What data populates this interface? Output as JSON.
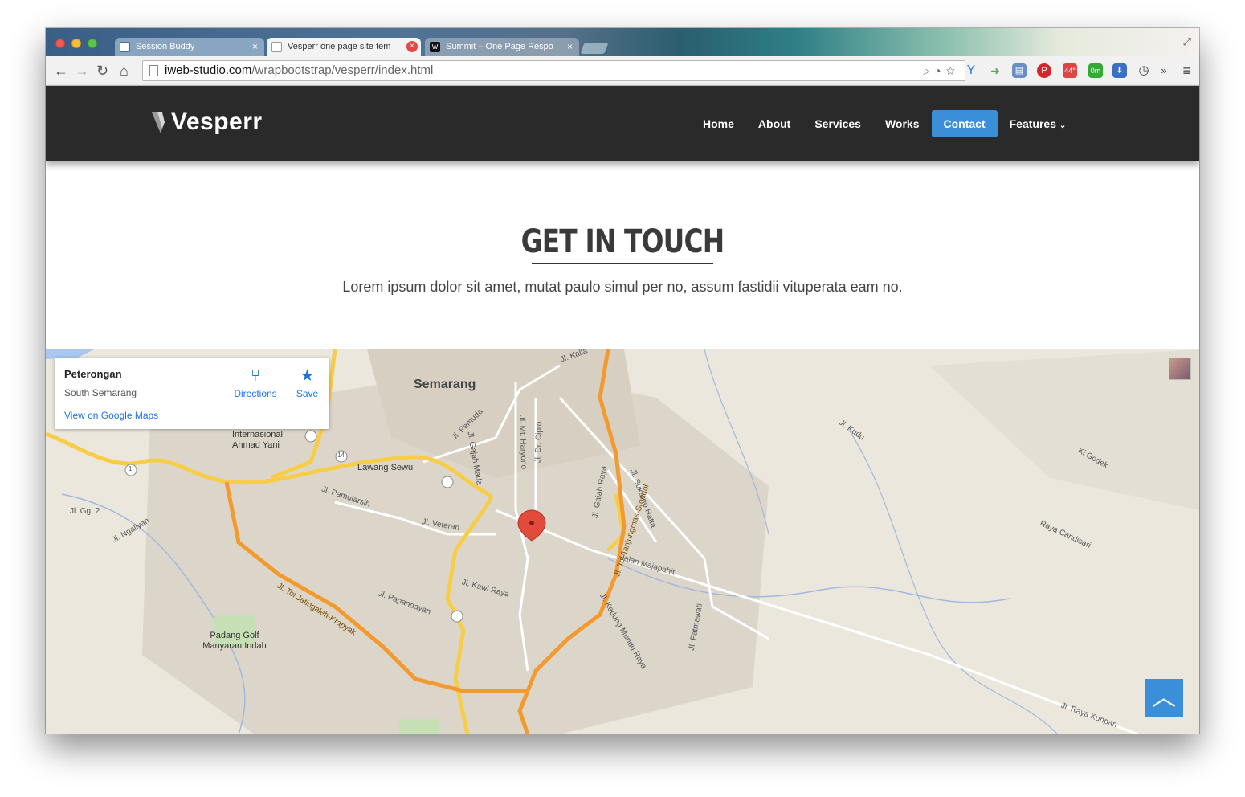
{
  "browser": {
    "tabs": [
      {
        "title": "Session Buddy",
        "close": "×"
      },
      {
        "title": "Vesperr one page site tem",
        "close": "×"
      },
      {
        "title": "Summit – One Page Respo",
        "close": "×"
      }
    ],
    "url_domain": "iweb-studio.com",
    "url_path": "/wrapbootstrap/vesperr/index.html",
    "extensions": [
      {
        "icon": "pinterest-icon",
        "color": "#d4262f"
      },
      {
        "icon": "weather-badge",
        "text": "44°",
        "color": "#d44"
      },
      {
        "icon": "traffic-badge",
        "text": "0m",
        "color": "#3a3"
      }
    ]
  },
  "site": {
    "logo": "Vesperr",
    "nav": [
      "Home",
      "About",
      "Services",
      "Works",
      "Contact",
      "Features"
    ],
    "active_nav": "Contact",
    "accent_color": "#3b8fd9"
  },
  "contact": {
    "title": "GET IN TOUCH",
    "description": "Lorem ipsum dolor sit amet, mutat paulo simul per no, assum fastidii vituperata eam no."
  },
  "map": {
    "info": {
      "place": "Peterongan",
      "area": "South Semarang",
      "link": "View on Google Maps",
      "directions": "Directions",
      "save": "Save"
    },
    "labels": {
      "city": "Semarang",
      "airport": "Internasional Ahmad Yani",
      "lawang": "Lawang Sewu",
      "golf": "Padang Golf Manyaran Indah",
      "jalan_majapahit": "Jalan Majapahit",
      "jl_pemuda": "Jl. Pemuda",
      "jl_gajah_mada": "Jl. Gajah Mada",
      "jl_mt_haryono": "Jl. Mt. Haryono",
      "jl_dr_cipto": "Jl. Dr. Cipto",
      "jl_pamularsih": "Jl. Pamularsih",
      "jl_veteran": "Jl. Veteran",
      "jl_ngaliyan": "Jl. Ngaliyan",
      "jl_papandayan": "Jl. Papandayan",
      "jl_kawi_raya": "Jl. Kawi Raya",
      "jl_gajah_raya": "Jl. Gajah Raya",
      "jl_sukarno_hatta": "Jl. Sukarno Hatta",
      "jl_kedung_mundu": "Jl. Kedung Mundu Raya",
      "jl_fatmawati": "Jl. Fatmawati",
      "jl_raya_kunpan": "Jl. Raya Kunpan",
      "jl_tol_jatingaleh": "Jl. Tol Jatingaleh-Krapyak",
      "jl_tol_tanjung": "Jl. Tol Tanjungmas-Srondol",
      "raya_candisari": "Raya Candisari",
      "jl_kalla": "Jl. Kalla",
      "jl_kudu": "Jl. Kudu",
      "ki_godek": "Ki Godek",
      "jl_gg2": "Jl. Gg. 2",
      "route_14": "14",
      "route_1": "1"
    }
  }
}
